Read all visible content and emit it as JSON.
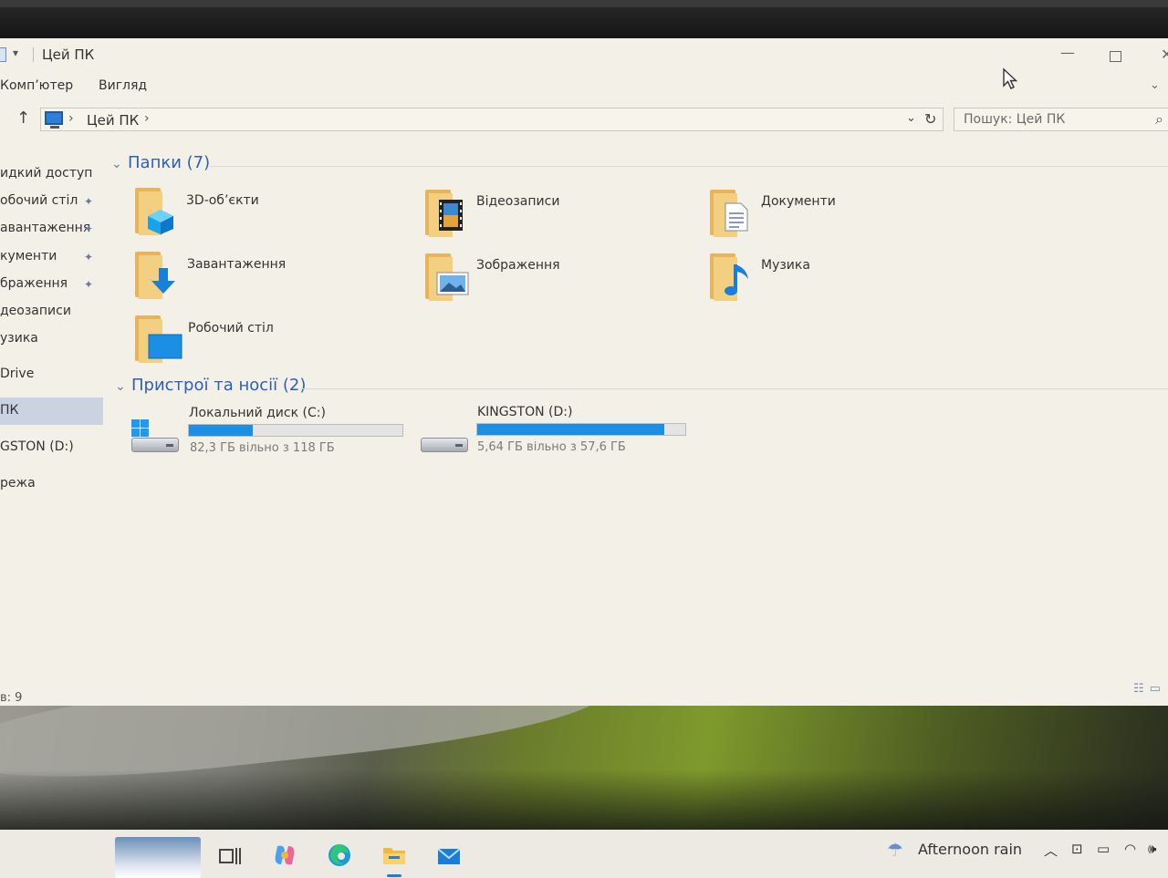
{
  "window": {
    "title": "Цей ПК",
    "ribbon_tabs": [
      "Комп’ютер",
      "Вигляд"
    ]
  },
  "address": {
    "path": "Цей ПК",
    "search_placeholder": "Пошук: Цей ПК"
  },
  "nav": {
    "items": [
      {
        "label": "идкий доступ",
        "pinned": false
      },
      {
        "label": "обочий стіл",
        "pinned": true
      },
      {
        "label": "авантаження",
        "pinned": true
      },
      {
        "label": "кументи",
        "pinned": true
      },
      {
        "label": "браження",
        "pinned": true
      },
      {
        "label": "деозаписи",
        "pinned": false
      },
      {
        "label": "узика",
        "pinned": false
      },
      {
        "label": "Drive",
        "pinned": false
      },
      {
        "label": " ПК",
        "pinned": false,
        "selected": true
      },
      {
        "label": "GSTON (D:)",
        "pinned": false
      },
      {
        "label": "режа",
        "pinned": false
      }
    ]
  },
  "folders_section": {
    "heading": "Папки (7)",
    "items": [
      {
        "label": "3D-об’єкти",
        "icon": "cube-icon"
      },
      {
        "label": "Відеозаписи",
        "icon": "film-icon"
      },
      {
        "label": "Документи",
        "icon": "document-icon"
      },
      {
        "label": "Завантаження",
        "icon": "download-arrow-icon"
      },
      {
        "label": "Зображення",
        "icon": "picture-icon"
      },
      {
        "label": "Музика",
        "icon": "music-note-icon"
      },
      {
        "label": "Робочий стіл",
        "icon": "desktop-icon"
      }
    ]
  },
  "devices_section": {
    "heading": "Пристрої та носії (2)",
    "drives": [
      {
        "name": "Локальний диск (C:)",
        "free_text": "82,3 ГБ вільно з 118 ГБ",
        "used_fraction": 0.3,
        "has_windows_logo": true
      },
      {
        "name": "KINGSTON (D:)",
        "free_text": "5,64 ГБ вільно з 57,6 ГБ",
        "used_fraction": 0.9,
        "has_windows_logo": false
      }
    ]
  },
  "status": {
    "text": "в: 9"
  },
  "taskbar": {
    "weather": "Afternoon rain"
  },
  "colors": {
    "accent": "#1a8fe3",
    "section_heading": "#2f5fb3",
    "folder": "#f3cf82"
  }
}
